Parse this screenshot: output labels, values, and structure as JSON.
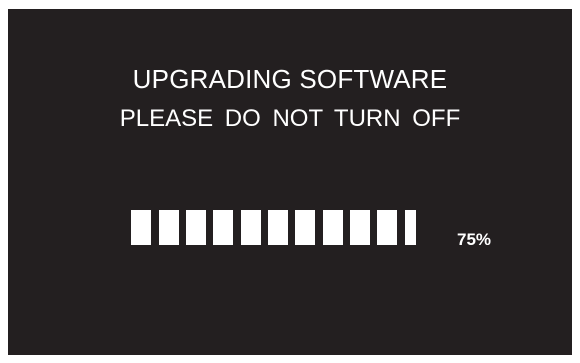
{
  "screen": {
    "title": "UPGRADING SOFTWARE",
    "warning": "PLEASE DO NOT TURN OFF"
  },
  "progress": {
    "value": 0.75,
    "label": "75%",
    "segments_filled": 10
  },
  "colors": {
    "background": "#231f20",
    "foreground": "#ffffff"
  }
}
